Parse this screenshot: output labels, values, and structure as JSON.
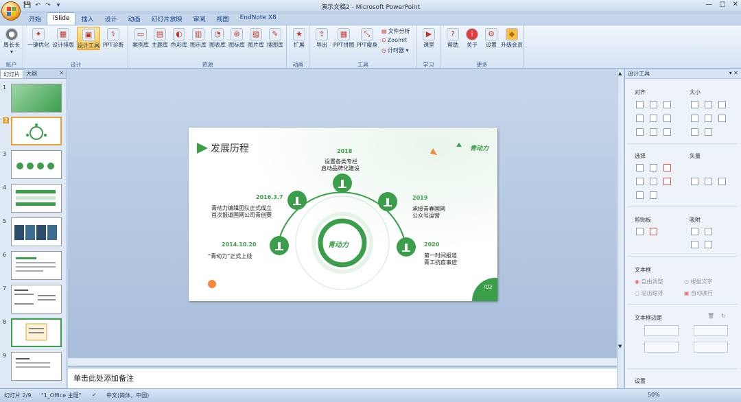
{
  "window": {
    "title": "演示文稿2 - Microsoft PowerPoint",
    "controls": [
      "—",
      "□",
      "✕"
    ]
  },
  "tabs": [
    "开始",
    "iSlide",
    "插入",
    "设计",
    "动画",
    "幻灯片放映",
    "审阅",
    "视图",
    "EndNote X8"
  ],
  "ribbon": {
    "account": {
      "label": "账户",
      "buttons": [
        {
          "label": "周长长",
          "sub": "▾"
        }
      ]
    },
    "design": {
      "label": "设计",
      "buttons": [
        "一键优化",
        "设计排版",
        "设计工具",
        "PPT诊断"
      ]
    },
    "resources": {
      "label": "资源",
      "buttons": [
        "案例库",
        "主题库",
        "色彩库",
        "图示库",
        "图表库",
        "图标库",
        "图片库",
        "插图库"
      ]
    },
    "animation": {
      "label": "动画",
      "buttons": [
        "扩展"
      ]
    },
    "tools": {
      "label": "工具",
      "buttons": [
        "导出",
        "PPT拼图",
        "PPT瘦身"
      ],
      "small": [
        "文件分析",
        "ZoomIt",
        "计时器 ▾"
      ]
    },
    "learning": {
      "label": "学习",
      "buttons": [
        "课堂"
      ]
    },
    "more": {
      "label": "更多",
      "buttons": [
        "帮助",
        "关于",
        "设置",
        "升级会员"
      ]
    }
  },
  "left_pane": {
    "tabs": [
      "幻灯片",
      "大纲"
    ],
    "close": "✕",
    "slide_numbers": [
      "1",
      "2",
      "3",
      "4",
      "5",
      "6",
      "7",
      "8",
      "9"
    ]
  },
  "slide": {
    "title": "发展历程",
    "logo": "青动力",
    "milestones": [
      {
        "year": "2018",
        "lines": [
          "设置各类专栏",
          "启动品牌化建设"
        ]
      },
      {
        "year": "2016.3.7",
        "lines": [
          "青动力编辑团队正式成立",
          "首次报道国网公司青创赛"
        ]
      },
      {
        "year": "2019",
        "lines": [
          "承接青春国网",
          "公众号运营"
        ]
      },
      {
        "year": "2014.10.20",
        "lines": [
          "“青动力”正式上线"
        ]
      },
      {
        "year": "2020",
        "lines": [
          "第一时间报道",
          "青工抗疫事迹"
        ]
      }
    ],
    "page_tag": "/02",
    "colors": {
      "green": "#3a9e4a",
      "orange": "#f08a3c"
    }
  },
  "notes": {
    "placeholder": "单击此处添加备注"
  },
  "right_pane": {
    "title": "设计工具",
    "sections": {
      "align": "对齐",
      "size": "大小",
      "select": "选择",
      "vector": "矢量",
      "clipboard": "剪贴板",
      "snap": "吸附",
      "textbox": "文本框",
      "margins": "文本框边距",
      "settings": "设置"
    },
    "textbox_options": [
      "自由调整",
      "根据文字",
      "溢出缩排",
      "自动换行"
    ]
  },
  "status": {
    "slide": "幻灯片 2/9",
    "theme": "\"1_Office 主题\"",
    "lang": "中文(简体，中国)",
    "zoom": "50%"
  }
}
